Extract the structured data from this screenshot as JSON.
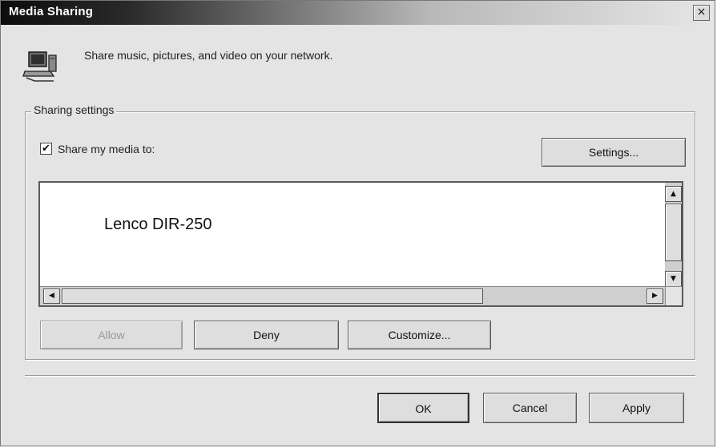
{
  "window": {
    "title": "Media Sharing",
    "close_glyph": "×"
  },
  "header": {
    "icon": "network-computer-icon",
    "text": "Share music, pictures, and video on your network."
  },
  "sharing_settings": {
    "legend": "Sharing settings",
    "share_checkbox": {
      "label": "Share my media to:",
      "checked": true,
      "glyph": "✔"
    },
    "settings_button_label": "Settings...",
    "device_list": {
      "items": [
        "Lenco DIR-250"
      ],
      "scroll_glyphs": {
        "up": "▲",
        "down": "▼",
        "left": "◀",
        "right": "▶"
      }
    },
    "allow_button_label": "Allow",
    "allow_enabled": false,
    "deny_button_label": "Deny",
    "customize_button_label": "Customize..."
  },
  "footer": {
    "ok_label": "OK",
    "cancel_label": "Cancel",
    "apply_label": "Apply"
  },
  "colors": {
    "titlebar_dark": "#0c0c0c",
    "titlebar_light": "#e6e6e6",
    "dialog_bg": "#e4e4e4",
    "disabled_text": "#9a9a9a"
  }
}
